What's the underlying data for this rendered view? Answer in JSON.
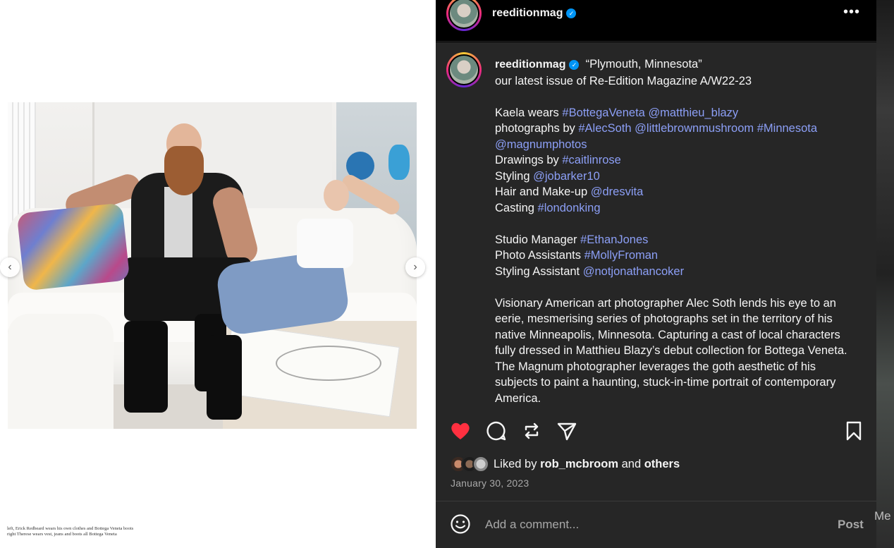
{
  "post": {
    "username": "reeditionmag",
    "location": "“Plymouth, Minnesota”",
    "caption_image_text": "left, Erick Redbeard wears his own clothes and Bottega Veneta boots\nright Therese wears vest, jeans and boots all Bottega Veneta"
  },
  "caption": {
    "lines": [
      [
        {
          "t": "our latest issue of Re-Edition Magazine A/W22-23"
        }
      ],
      [],
      [
        {
          "t": "Kaela wears "
        },
        {
          "t": "#BottegaVeneta",
          "link": true
        },
        {
          "t": " "
        },
        {
          "t": "@matthieu_blazy",
          "link": true
        }
      ],
      [
        {
          "t": "photographs by "
        },
        {
          "t": "#AlecSoth",
          "link": true
        },
        {
          "t": " "
        },
        {
          "t": "@littlebrownmushroom",
          "link": true
        },
        {
          "t": " "
        },
        {
          "t": "#Minnesota",
          "link": true
        }
      ],
      [
        {
          "t": "@magnumphotos",
          "link": true
        }
      ],
      [
        {
          "t": "Drawings by "
        },
        {
          "t": "#caitlinrose",
          "link": true
        }
      ],
      [
        {
          "t": "Styling "
        },
        {
          "t": "@jobarker10",
          "link": true
        }
      ],
      [
        {
          "t": "Hair and Make-up "
        },
        {
          "t": "@dresvita",
          "link": true
        }
      ],
      [
        {
          "t": "Casting "
        },
        {
          "t": "#londonking",
          "link": true
        }
      ],
      [],
      [
        {
          "t": "Studio Manager "
        },
        {
          "t": "#EthanJones",
          "link": true
        }
      ],
      [
        {
          "t": "Photo Assistants "
        },
        {
          "t": "#MollyFroman",
          "link": true
        }
      ],
      [
        {
          "t": "Styling Assistant "
        },
        {
          "t": "@notjonathancoker",
          "link": true
        }
      ],
      []
    ],
    "paragraph": "Visionary American art photographer Alec Soth lends his eye to an eerie, mesmerising series of photographs set in the territory of his native Minneapolis, Minnesota. Capturing a cast of local characters fully dressed in Matthieu Blazy’s debut collection for Bottega Veneta. The Magnum photographer leverages the goth aesthetic of his subjects to paint a haunting, stuck-in-time portrait of contemporary America."
  },
  "engagement": {
    "liked_by_prefix": "Liked by",
    "liked_by_user": "rob_mcbroom",
    "liked_by_and": "and",
    "liked_by_others": "others",
    "date": "January 30, 2023"
  },
  "comment_box": {
    "placeholder": "Add a comment...",
    "post_label": "Post"
  },
  "side_peek_text": "Me",
  "colors": {
    "like_red": "#ff3040",
    "link_blue": "#8c9ff6",
    "verified_blue": "#0095f6",
    "panel_bg": "#262626"
  },
  "icons": {
    "more": "more-horizontal-icon",
    "like": "heart-icon",
    "comment": "comment-bubble-icon",
    "share": "repost-icon",
    "send": "send-paper-plane-icon",
    "save": "bookmark-icon",
    "emoji": "emoji-smile-icon",
    "prev": "chevron-left-icon",
    "next": "chevron-right-icon"
  }
}
